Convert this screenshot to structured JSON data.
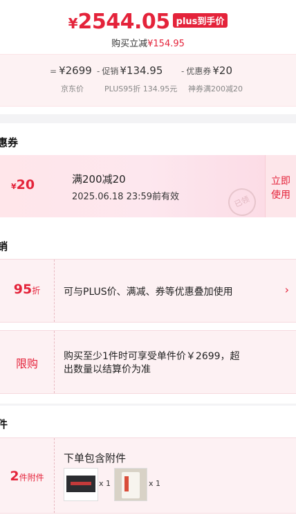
{
  "top": {
    "currency": "¥",
    "price": "2544.05",
    "plus_tag": "plus到手价",
    "buy_reduce_label": "购买立减",
    "buy_reduce_value": "¥154.95"
  },
  "breakdown": {
    "items": [
      {
        "op": "=",
        "label": "",
        "value": "¥2699",
        "sub": "京东价"
      },
      {
        "op": "-",
        "label": "促销",
        "value": "¥134.95",
        "sub": "PLUS95折 134.95元"
      },
      {
        "op": "-",
        "label": "优惠券",
        "value": "¥20",
        "sub": "神券满200减20"
      }
    ]
  },
  "coupon_section": {
    "title": "惠券",
    "amount_currency": "¥",
    "amount": "20",
    "condition": "满200减20",
    "valid": "2025.06.18 23:59前有效",
    "use_btn_line1": "立即",
    "use_btn_line2": "使用",
    "stamp": "已领"
  },
  "promo_section": {
    "title": "销",
    "plus_discount_num": "95",
    "plus_discount_unit": "折",
    "plus_desc": "可与PLUS价、满减、券等优惠叠加使用",
    "arrow": "›",
    "limit_label": "限购",
    "limit_desc_line1": "购买至少1件时可享受单件价￥2699，超",
    "limit_desc_line2": "出数量以结算价为准"
  },
  "accessory_section": {
    "title": "件",
    "count_num": "2",
    "count_unit": "件附件",
    "desc": "下单包含附件",
    "item1_qty": "x 1",
    "item2_qty": "x 1"
  }
}
